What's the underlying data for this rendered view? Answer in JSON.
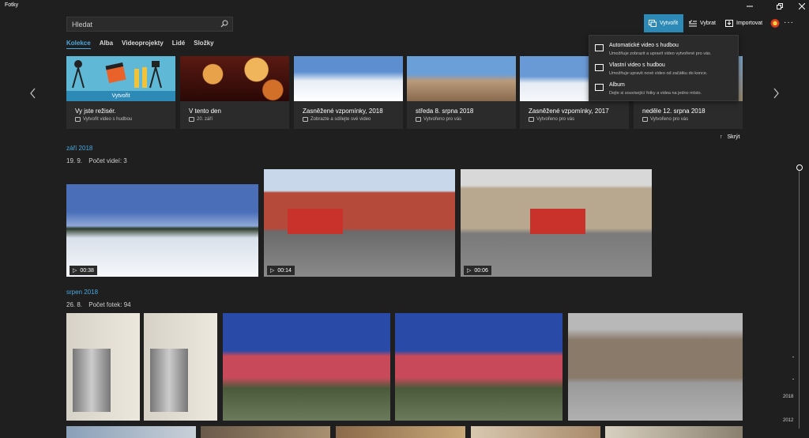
{
  "app": {
    "title": "Fotky"
  },
  "search": {
    "value": "Hledat"
  },
  "toolbar": {
    "create_label": "Vytvořit",
    "select_label": "Vybrat",
    "import_label": "Importovat",
    "more_label": "···"
  },
  "nav": {
    "tabs": [
      "Kolekce",
      "Alba",
      "Videoprojekty",
      "Lidé",
      "Složky"
    ],
    "active": "Kolekce"
  },
  "cards": [
    {
      "title": "Vy jste režisér.",
      "subtitle": "Vytvořit video s hudbou",
      "overlay": "Vytvořit"
    },
    {
      "title": "V tento den",
      "subtitle": "20. září"
    },
    {
      "title": "Zasněžené vzpomínky, 2018",
      "subtitle": "Zobrazte a sdílejte své video"
    },
    {
      "title": "středa 8. srpna 2018",
      "subtitle": "Vytvořeno pro vás"
    },
    {
      "title": "Zasněžené vzpomínky, 2017",
      "subtitle": "Vytvořeno pro vás"
    },
    {
      "title": "neděle 12. srpna 2018",
      "subtitle": "Vytvořeno pro vás"
    }
  ],
  "create_menu": [
    {
      "title": "Automatické video s hudbou",
      "desc": "Umožňuje zobrazit a upravit video vytvořené pro vás."
    },
    {
      "title": "Vlastní video s hudbou",
      "desc": "Umožňuje upravit nové video od začátku do konce."
    },
    {
      "title": "Album",
      "desc": "Dejte si související fotky a videa na jedno místo."
    }
  ],
  "hide_label": "Skrýt",
  "sections": [
    {
      "title": "září 2018",
      "date": "19. 9.",
      "count": "Počet videí: 3",
      "durations": [
        "00:38",
        "00:14",
        "00:06"
      ]
    },
    {
      "title": "srpen 2018",
      "date": "26. 8.",
      "count": "Počet fotek: 94"
    }
  ],
  "scrubber": {
    "years": [
      "2018",
      "2012"
    ]
  },
  "colors": {
    "accent": "#2d8ab7",
    "link": "#4aa8de",
    "background": "#1f1f1f"
  }
}
